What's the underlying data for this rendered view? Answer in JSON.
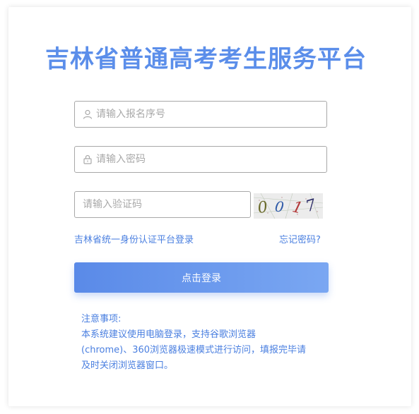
{
  "title": "吉林省普通高考考生服务平台",
  "form": {
    "username_placeholder": "请输入报名序号",
    "username_value": "",
    "password_placeholder": "请输入密码",
    "password_value": "",
    "captcha_placeholder": "请输入验证码",
    "captcha_value": "",
    "captcha_image_text": "0 0 1 7"
  },
  "links": {
    "sso_login": "吉林省统一身份认证平台登录",
    "forgot_password": "忘记密码?"
  },
  "buttons": {
    "login": "点击登录"
  },
  "notice": {
    "heading": "注意事项:",
    "line1": "本系统建议使用电脑登录，支持谷歌浏览器",
    "line2": "(chrome)、360浏览器极速模式进行访问，填报完毕请",
    "line3": "及时关闭浏览器窗口。"
  },
  "icons": {
    "username": "user-icon",
    "password": "lock-icon"
  },
  "colors": {
    "accent": "#5b8eea",
    "link": "#4a7fe0",
    "button_start": "#5a8ae8",
    "button_end": "#7aa7f2"
  }
}
